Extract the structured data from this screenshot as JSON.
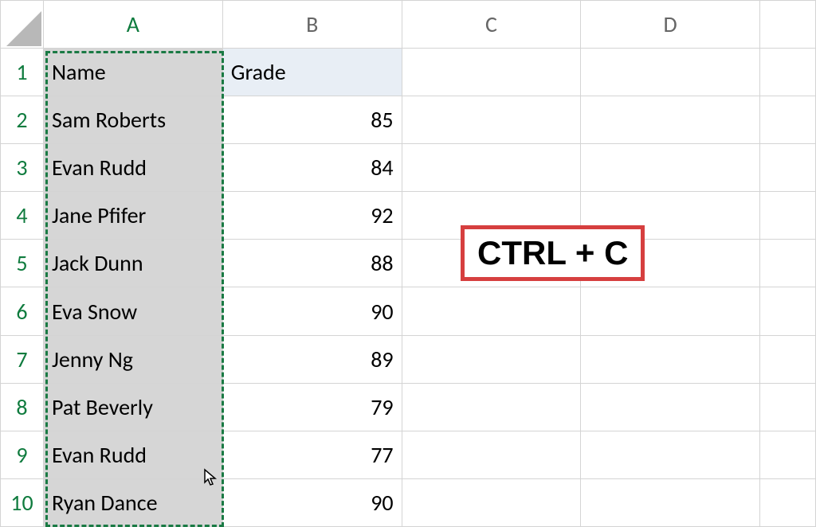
{
  "columns": {
    "A": "A",
    "B": "B",
    "C": "C",
    "D": "D"
  },
  "rows": {
    "1": "1",
    "2": "2",
    "3": "3",
    "4": "4",
    "5": "5",
    "6": "6",
    "7": "7",
    "8": "8",
    "9": "9",
    "10": "10"
  },
  "headers": {
    "A1": "Name",
    "B1": "Grade"
  },
  "data": {
    "A2": "Sam Roberts",
    "B2": "85",
    "A3": "Evan Rudd",
    "B3": "84",
    "A4": "Jane Pfifer",
    "B4": "92",
    "A5": "Jack Dunn",
    "B5": "88",
    "A6": "Eva Snow",
    "B6": "90",
    "A7": "Jenny Ng",
    "B7": "89",
    "A8": "Pat Beverly",
    "B8": "79",
    "A9": "Evan Rudd",
    "B9": "77",
    "A10": "Ryan Dance",
    "B10": "90"
  },
  "annotation": "CTRL + C"
}
